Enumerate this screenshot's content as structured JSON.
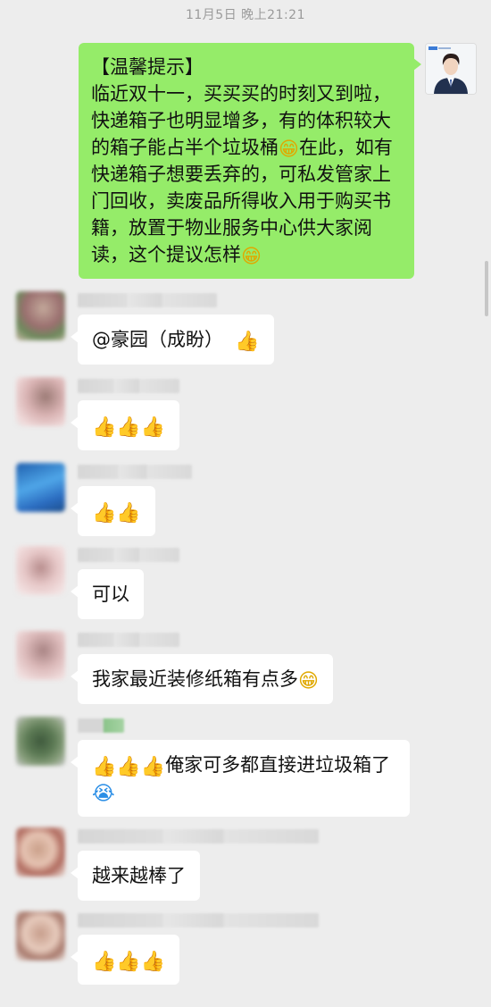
{
  "timestamp": "11月5日 晚上21:21",
  "outgoing": {
    "lines": [
      "【温馨提示】",
      "临近双十一，买买买的时刻又到啦，快递箱子也明显增多，有的体积较大的箱子能占半个垃圾桶"
    ],
    "line2_tail": "在此，如有快递箱子想要丢弃的，可私发管家上门回收，卖废品所得收入用于购买书籍，放置于物业服务中心供大家阅读，这个提议怎样",
    "emoji_grin": "😁"
  },
  "messages": [
    {
      "text": "@豪园（成盼）",
      "trail": "👍"
    },
    {
      "text": "",
      "trail": "👍👍👍"
    },
    {
      "text": "",
      "trail": "👍👍"
    },
    {
      "text": "可以",
      "trail": ""
    },
    {
      "text": "我家最近装修纸箱有点多",
      "trail": "😁"
    },
    {
      "lead": "👍👍👍",
      "text": "俺家可多都直接进垃圾箱了",
      "trail": "😭"
    },
    {
      "text": "越来越棒了",
      "trail": ""
    },
    {
      "text": "",
      "trail": "👍👍👍"
    }
  ]
}
